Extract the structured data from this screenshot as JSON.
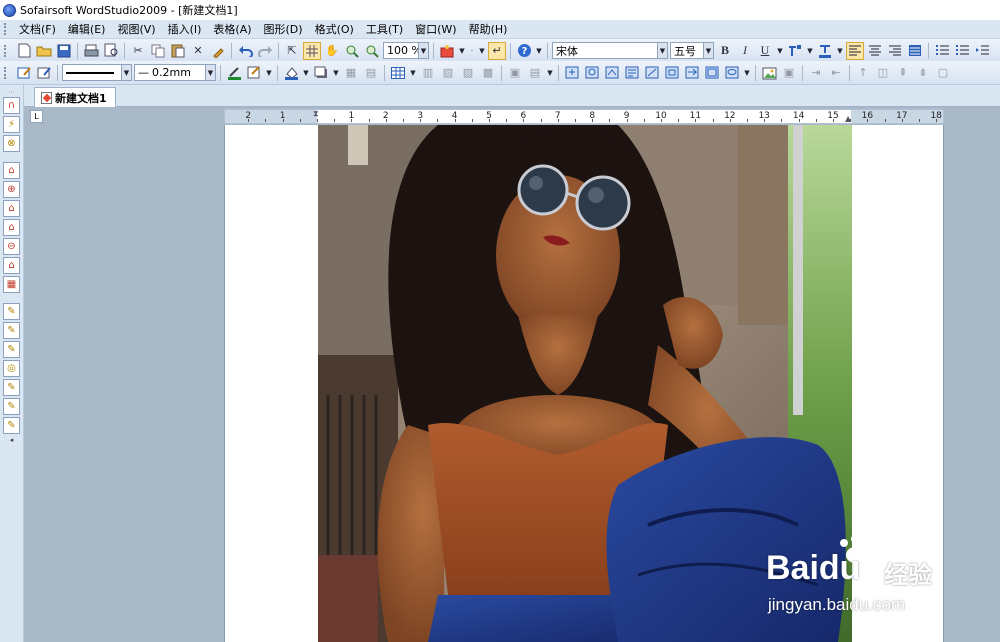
{
  "window": {
    "title": "Sofairsoft WordStudio2009 - [新建文档1]"
  },
  "menu": [
    "文档(F)",
    "编辑(E)",
    "视图(V)",
    "插入(I)",
    "表格(A)",
    "图形(D)",
    "格式(O)",
    "工具(T)",
    "窗口(W)",
    "帮助(H)"
  ],
  "toolbar": {
    "zoom": "100 %",
    "font_name": "宋体",
    "font_size": "五号",
    "bold": "B",
    "italic": "I",
    "underline": "U",
    "line_width": "0.2mm"
  },
  "tabs": {
    "active": "新建文档1"
  },
  "ruler": {
    "numbers": [
      "2",
      "1",
      "1",
      "2",
      "3",
      "4",
      "5",
      "6",
      "7",
      "8",
      "9",
      "10",
      "11",
      "12",
      "13",
      "14",
      "15",
      "16",
      "17",
      "18"
    ]
  },
  "watermark": {
    "logo": "Baidu",
    "cn": "经验",
    "url": "jingyan.baidu.com"
  }
}
